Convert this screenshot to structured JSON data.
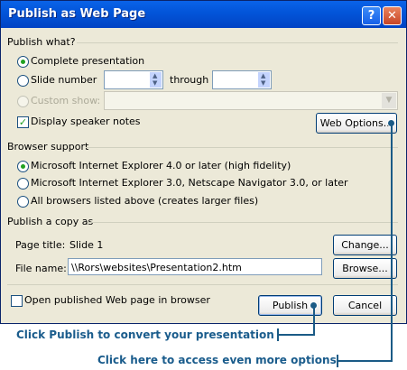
{
  "window": {
    "title": "Publish as Web Page",
    "help_label": "?",
    "close_label": "✕"
  },
  "publish_what": {
    "label": "Publish what?",
    "complete_presentation": "Complete presentation",
    "slide_number": "Slide number",
    "through": "through",
    "custom_show": "Custom show:",
    "display_speaker_notes": "Display speaker notes",
    "web_options_button": "Web Options..."
  },
  "browser_support": {
    "label": "Browser support",
    "option1": "Microsoft Internet Explorer 4.0 or later (high fidelity)",
    "option2": "Microsoft Internet Explorer 3.0, Netscape Navigator 3.0, or later",
    "option3": "All browsers listed above (creates larger files)"
  },
  "publish_copy": {
    "label": "Publish a copy as",
    "page_title_label": "Page title:",
    "page_title_value": "Slide 1",
    "change_button": "Change...",
    "file_name_label": "File name:",
    "file_name_value": "\\\\Rors\\websites\\Presentation2.htm",
    "browse_button": "Browse..."
  },
  "footer": {
    "open_in_browser": "Open published Web page in browser",
    "publish_button": "Publish",
    "cancel_button": "Cancel"
  },
  "callouts": {
    "publish": "Click Publish to convert your presentation",
    "web_options": "Click here to access even more options"
  },
  "colors": {
    "titlebar": "#0254d8",
    "dialog_bg": "#ece9d8",
    "callout": "#1a5c8c"
  }
}
